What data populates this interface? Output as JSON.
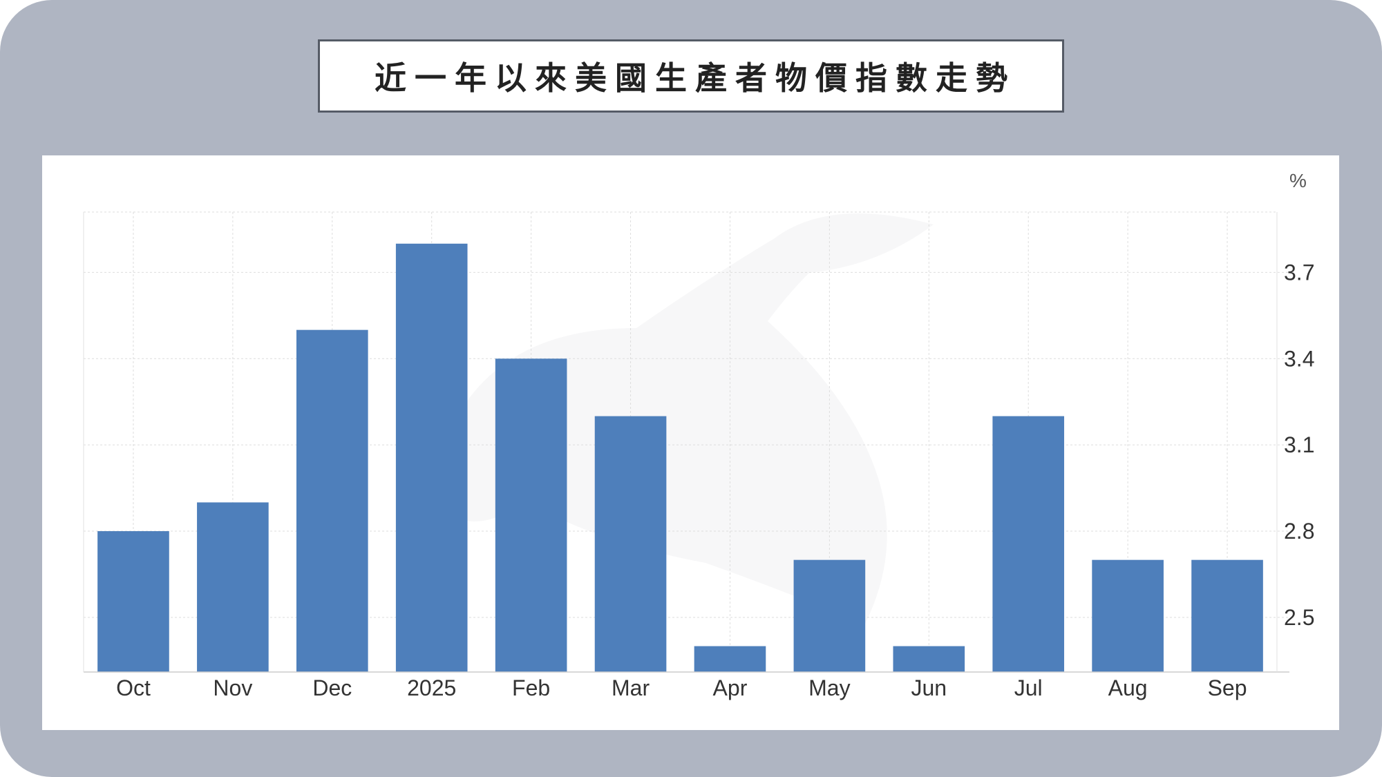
{
  "title": "近一年以來美國生產者物價指數走勢",
  "chart_data": {
    "type": "bar",
    "title": "近一年以來美國生產者物價指數走勢",
    "unit": "%",
    "categories": [
      "Oct",
      "Nov",
      "Dec",
      "2025",
      "Feb",
      "Mar",
      "Apr",
      "May",
      "Jun",
      "Jul",
      "Aug",
      "Sep"
    ],
    "values": [
      2.8,
      2.9,
      3.5,
      3.8,
      3.4,
      3.2,
      2.4,
      2.7,
      2.4,
      3.2,
      2.7,
      2.7
    ],
    "y_ticks": [
      "2.5",
      "2.8",
      "3.1",
      "3.4",
      "3.7"
    ],
    "ylim": [
      2.31,
      3.91
    ],
    "grid": true,
    "y_axis_side": "right",
    "bar_color": "#4e7fbb",
    "grid_color": "#dddddd",
    "frame_color": "#afb5c2"
  }
}
